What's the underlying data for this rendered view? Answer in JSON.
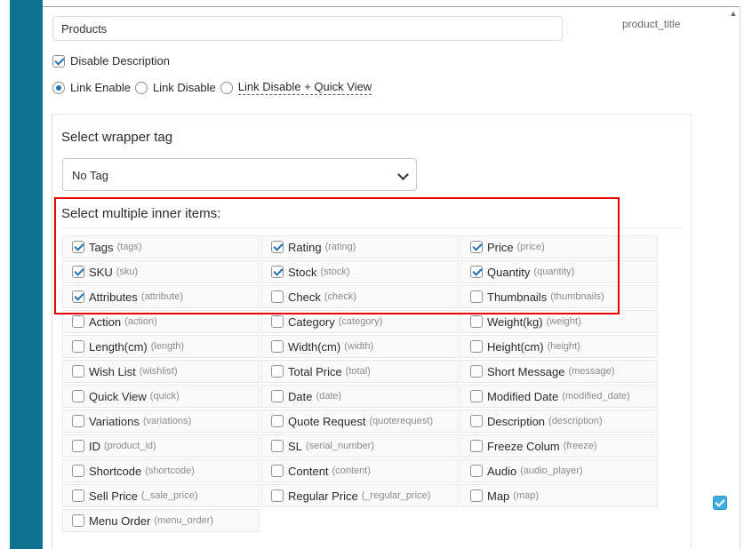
{
  "title_input": {
    "value": "Products"
  },
  "key_label": "product_title",
  "disable_description": {
    "label": "Disable Description",
    "checked": true
  },
  "link_options": [
    {
      "label": "Link Enable",
      "selected": true
    },
    {
      "label": "Link Disable",
      "selected": false
    },
    {
      "label": "Link Disable + Quick View",
      "selected": false
    }
  ],
  "wrapper": {
    "label": "Select wrapper tag",
    "selected": "No Tag"
  },
  "inner_items": {
    "label": "Select multiple inner items:",
    "items": [
      {
        "name": "Tags",
        "key": "(tags)",
        "checked": true
      },
      {
        "name": "Rating",
        "key": "(rating)",
        "checked": true
      },
      {
        "name": "Price",
        "key": "(price)",
        "checked": true
      },
      {
        "name": "SKU",
        "key": "(sku)",
        "checked": true
      },
      {
        "name": "Stock",
        "key": "(stock)",
        "checked": true
      },
      {
        "name": "Quantity",
        "key": "(quantity)",
        "checked": true
      },
      {
        "name": "Attributes",
        "key": "(attribute)",
        "checked": true
      },
      {
        "name": "Check",
        "key": "(check)",
        "checked": false
      },
      {
        "name": "Thumbnails",
        "key": "(thumbnails)",
        "checked": false
      },
      {
        "name": "Action",
        "key": "(action)",
        "checked": false
      },
      {
        "name": "Category",
        "key": "(category)",
        "checked": false
      },
      {
        "name": "Weight(kg)",
        "key": "(weight)",
        "checked": false
      },
      {
        "name": "Length(cm)",
        "key": "(length)",
        "checked": false
      },
      {
        "name": "Width(cm)",
        "key": "(width)",
        "checked": false
      },
      {
        "name": "Height(cm)",
        "key": "(height)",
        "checked": false
      },
      {
        "name": "Wish List",
        "key": "(wishlist)",
        "checked": false
      },
      {
        "name": "Total Price",
        "key": "(total)",
        "checked": false
      },
      {
        "name": "Short Message",
        "key": "(message)",
        "checked": false
      },
      {
        "name": "Quick View",
        "key": "(quick)",
        "checked": false
      },
      {
        "name": "Date",
        "key": "(date)",
        "checked": false
      },
      {
        "name": "Modified Date",
        "key": "(modified_date)",
        "checked": false
      },
      {
        "name": "Variations",
        "key": "(variations)",
        "checked": false
      },
      {
        "name": "Quote Request",
        "key": "(quoterequest)",
        "checked": false
      },
      {
        "name": "Description",
        "key": "(description)",
        "checked": false
      },
      {
        "name": "ID",
        "key": "(product_id)",
        "checked": false
      },
      {
        "name": "SL",
        "key": "(serial_number)",
        "checked": false
      },
      {
        "name": "Freeze Colum",
        "key": "(freeze)",
        "checked": false
      },
      {
        "name": "Shortcode",
        "key": "(shortcode)",
        "checked": false
      },
      {
        "name": "Content",
        "key": "(content)",
        "checked": false
      },
      {
        "name": "Audio",
        "key": "(audio_player)",
        "checked": false
      },
      {
        "name": "Sell Price",
        "key": "(_sale_price)",
        "checked": false
      },
      {
        "name": "Regular Price",
        "key": "(_regular_price)",
        "checked": false
      },
      {
        "name": "Map",
        "key": "(map)",
        "checked": false
      },
      {
        "name": "Menu Order",
        "key": "(menu_order)",
        "checked": false
      }
    ]
  },
  "side_checkbox": {
    "checked": true
  },
  "colors": {
    "sidebar": "#0d7391",
    "highlight": "#e00000",
    "accent": "#2271b1"
  }
}
